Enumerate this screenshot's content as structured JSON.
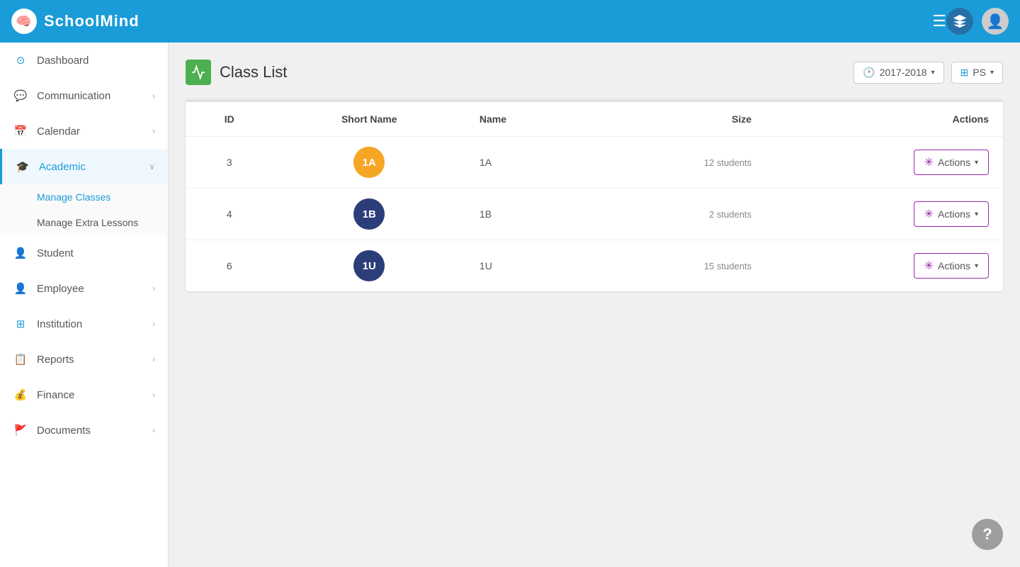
{
  "app": {
    "name": "SchoolMind"
  },
  "header": {
    "menu_icon": "☰",
    "year_selector": "2017-2018",
    "school_selector": "PS"
  },
  "sidebar": {
    "items": [
      {
        "id": "dashboard",
        "label": "Dashboard",
        "icon": "⊙",
        "icon_color": "#1a9cd8",
        "has_chevron": false,
        "active": false
      },
      {
        "id": "communication",
        "label": "Communication",
        "icon": "💬",
        "icon_color": "#1a9cd8",
        "has_chevron": true,
        "active": false
      },
      {
        "id": "calendar",
        "label": "Calendar",
        "icon": "📅",
        "icon_color": "#e53935",
        "has_chevron": true,
        "active": false
      },
      {
        "id": "academic",
        "label": "Academic",
        "icon": "🎓",
        "icon_color": "#1a9cd8",
        "has_chevron": true,
        "active": true
      },
      {
        "id": "student",
        "label": "Student",
        "icon": "👤",
        "icon_color": "#555",
        "has_chevron": false,
        "active": false
      },
      {
        "id": "employee",
        "label": "Employee",
        "icon": "👤",
        "icon_color": "#555",
        "has_chevron": true,
        "active": false
      },
      {
        "id": "institution",
        "label": "Institution",
        "icon": "⊞",
        "icon_color": "#1a9cd8",
        "has_chevron": true,
        "active": false
      },
      {
        "id": "reports",
        "label": "Reports",
        "icon": "📋",
        "icon_color": "#555",
        "has_chevron": true,
        "active": false
      },
      {
        "id": "finance",
        "label": "Finance",
        "icon": "💰",
        "icon_color": "#f5a623",
        "has_chevron": true,
        "active": false
      },
      {
        "id": "documents",
        "label": "Documents",
        "icon": "🚩",
        "icon_color": "#e53935",
        "has_chevron": true,
        "active": false
      }
    ],
    "academic_submenu": [
      {
        "id": "manage-classes",
        "label": "Manage Classes",
        "active": true
      },
      {
        "id": "manage-extra-lessons",
        "label": "Manage Extra Lessons",
        "active": false
      }
    ]
  },
  "page": {
    "title": "Class List",
    "year": "2017-2018",
    "school": "PS"
  },
  "table": {
    "columns": [
      {
        "id": "id",
        "label": "ID"
      },
      {
        "id": "short_name",
        "label": "Short Name"
      },
      {
        "id": "name",
        "label": "Name"
      },
      {
        "id": "size",
        "label": "Size"
      },
      {
        "id": "actions",
        "label": "Actions"
      }
    ],
    "rows": [
      {
        "id": "3",
        "short_name": "1A",
        "badge_color": "orange",
        "name": "1A",
        "size": "12 students",
        "actions": "Actions"
      },
      {
        "id": "4",
        "short_name": "1B",
        "badge_color": "darkblue",
        "name": "1B",
        "size": "2 students",
        "actions": "Actions"
      },
      {
        "id": "6",
        "short_name": "1U",
        "badge_color": "navy",
        "name": "1U",
        "size": "15 students",
        "actions": "Actions"
      }
    ]
  },
  "help": {
    "label": "?"
  }
}
